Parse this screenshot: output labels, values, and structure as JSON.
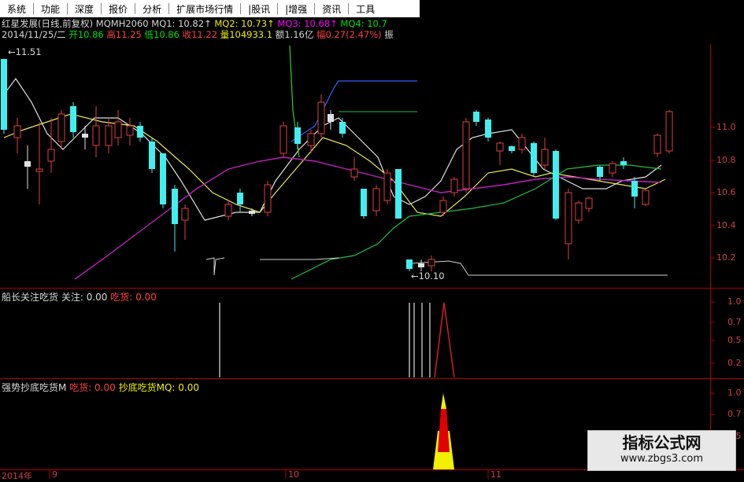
{
  "menu": [
    "系统",
    "功能",
    "深度",
    "报价",
    "分析",
    "扩展市场行情",
    "|股讯",
    "|增强",
    "资讯",
    "工具"
  ],
  "header": {
    "stock": "红星发展(日线,前复权)",
    "indicator": "MQMH2060",
    "mq1": "MQ1: 10.82↑",
    "mq2": "MQ2: 10.73↑",
    "mq3": "MQ3: 10.68↑",
    "mq4": "MQ4: 10.7"
  },
  "quote": {
    "date": "2014/11/25/二",
    "open": "开10.86",
    "high": "高11.25",
    "low": "低10.86",
    "close": "收11.22",
    "volume": "量104933.1",
    "amount": "额1.16亿",
    "change": "幅0.27(2.47%)",
    "extra": "振"
  },
  "price_axis": [
    "11.0",
    "10.8",
    "10.6",
    "10.4",
    "10.2"
  ],
  "markers": {
    "high": "11.51",
    "low": "10.10"
  },
  "panel1": {
    "name": "船长关注吃货",
    "s1": "关注: 0.00",
    "s2": "吃货: 0.00",
    "axis": [
      "1.0",
      "0.7",
      "0.5",
      "0.2"
    ]
  },
  "panel2": {
    "name": "强势抄底吃货M",
    "s1": "吃货: 0.00",
    "s2": "抄底吃货MQ: 0.00",
    "axis": [
      "1.0",
      "0.7",
      "0.5"
    ]
  },
  "dates": [
    "2014年",
    "9",
    "10",
    "11"
  ],
  "watermark": {
    "title": "指标公式网",
    "url": "www.zbgs3.com"
  }
}
